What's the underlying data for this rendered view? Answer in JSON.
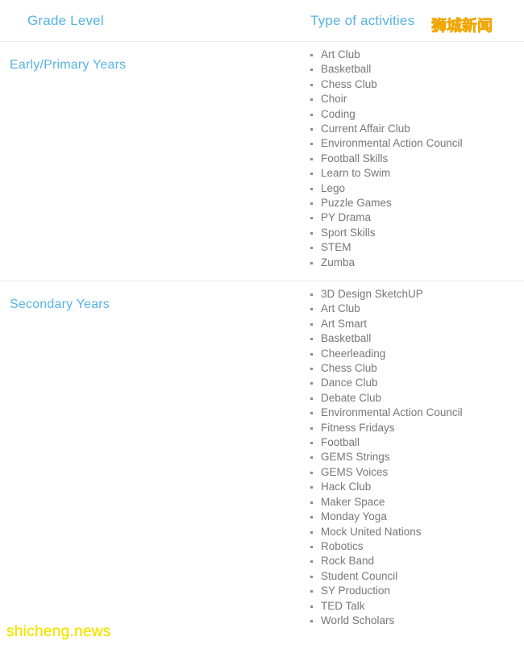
{
  "header": {
    "grade_level_label": "Grade Level",
    "type_of_activities_label": "Type of activities",
    "watermark_cn": "狮城新闻"
  },
  "footer": {
    "watermark_site": "shicheng.news"
  },
  "colors": {
    "heading_blue": "#56b3e4",
    "list_text_gray": "#777777",
    "divider": "#e9e9e9",
    "watermark_yellow": "#ffe400"
  },
  "rows": [
    {
      "grade_level": "Early/Primary Years",
      "activities": [
        "Art Club",
        "Basketball",
        "Chess Club",
        "Choir",
        "Coding",
        "Current Affair Club",
        "Environmental Action Council",
        "Football Skills",
        "Learn to Swim",
        "Lego",
        "Puzzle Games",
        "PY Drama",
        "Sport Skills",
        "STEM",
        "Zumba"
      ]
    },
    {
      "grade_level": "Secondary Years",
      "activities": [
        "3D Design SketchUP",
        "Art Club",
        "Art Smart",
        "Basketball",
        "Cheerleading",
        "Chess Club",
        "Dance Club",
        "Debate Club",
        "Environmental Action Council",
        "Fitness Fridays",
        "Football",
        "GEMS Strings",
        "GEMS Voices",
        "Hack Club",
        "Maker Space",
        "Monday Yoga",
        "Mock United Nations",
        "Robotics",
        "Rock Band",
        "Student Council",
        "SY Production",
        "TED Talk",
        "World Scholars"
      ]
    }
  ]
}
